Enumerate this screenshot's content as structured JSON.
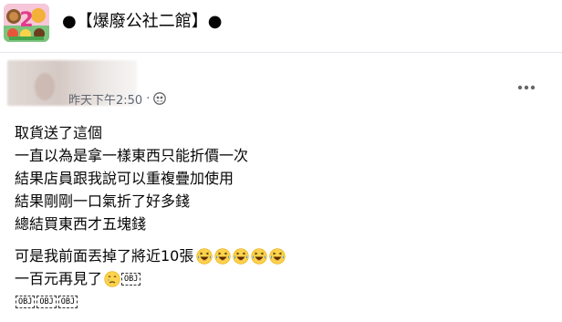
{
  "group": {
    "title": "●【爆廢公社二館】●",
    "logo_icon": "bear-mascot-logo-icon"
  },
  "post": {
    "timestamp": "昨天下午2:50",
    "separator": "·",
    "audience_icon": "group-members-icon",
    "more_icon": "more-dots-icon",
    "lines": [
      "取貨送了這個",
      "一直以為是拿一樣東西只能折價一次",
      "結果店員跟我說可以重複疊加使用",
      "結果剛剛一口氣折了好多錢",
      "總結買東西才五塊錢"
    ],
    "line_lost": "可是我前面丟掉了將近10張",
    "laugh_emoji_count": 5,
    "laugh_emoji": "laugh-cry-emoji",
    "line_goodbye": "一百元再見了",
    "sad_emoji": "crying-emoji",
    "obj_label": "OBJ"
  },
  "colors": {
    "text": "#050505",
    "meta": "#65676b",
    "divider": "#e4e6eb"
  }
}
